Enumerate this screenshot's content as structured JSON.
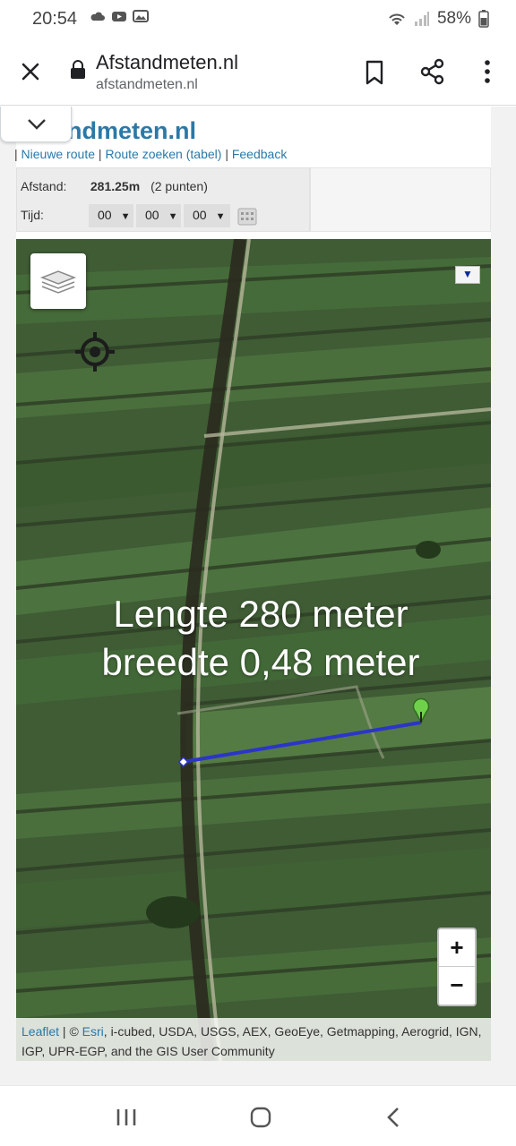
{
  "status_bar": {
    "time": "20:54",
    "battery": "58%",
    "icons": [
      "cloud-icon",
      "youtube-icon",
      "photo-icon",
      "wifi-icon",
      "signal-icon",
      "battery-icon"
    ]
  },
  "toolbar": {
    "title": "Afstandmeten.nl",
    "url": "afstandmeten.nl",
    "icons": [
      "close-icon",
      "lock-icon",
      "bookmark-icon",
      "share-icon",
      "more-icon"
    ]
  },
  "page": {
    "site_title": "andmeten.nl",
    "nav": {
      "sep": "|",
      "link1": "Nieuwe route",
      "link2": "Route zoeken (tabel)",
      "link3": "Feedback"
    },
    "info": {
      "afstand_label": "Afstand:",
      "afstand_value": "281.25m",
      "afstand_points": "(2 punten)",
      "tijd_label": "Tijd:",
      "hours": "00",
      "minutes": "00",
      "seconds": "00"
    }
  },
  "map": {
    "overlay_line1": "Lengte 280 meter",
    "overlay_line2": "breedte 0,48 meter",
    "zoom_in": "+",
    "zoom_out": "−",
    "route_color": "#2b35c8",
    "marker_color": "#6fd14a",
    "attribution": {
      "leaflet": "Leaflet",
      "copyright": " | © ",
      "esri": "Esri",
      "rest": ", i-cubed, USDA, USGS, AEX, GeoEye, Getmapping, Aerogrid, IGN, IGP, UPR-EGP, and the GIS User Community"
    }
  },
  "colors": {
    "link": "#2a79a8",
    "field_green": "#3d5a33"
  }
}
